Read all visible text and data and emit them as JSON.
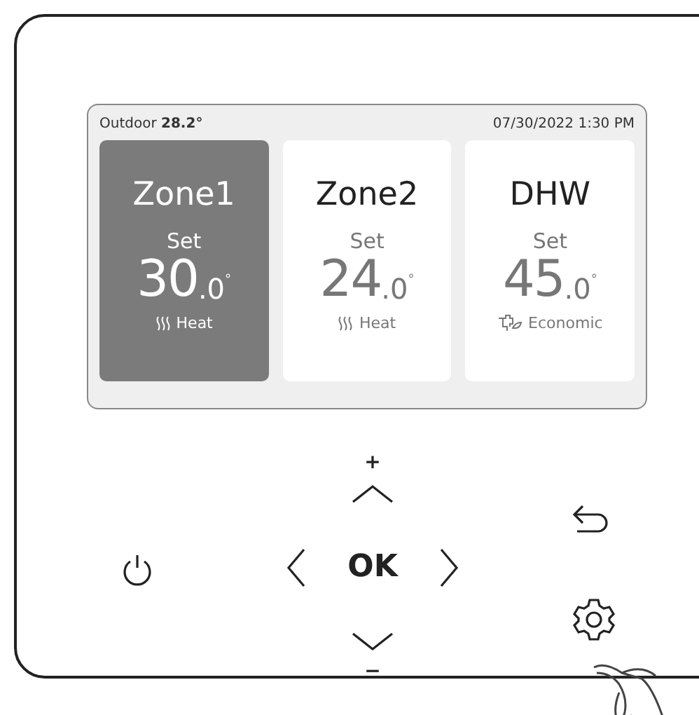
{
  "screen": {
    "outdoor": "Outdoor **28.2°**",
    "datetime": "07/30/2022 1:30 PM",
    "zones": [
      {
        "name": "Zone1",
        "set_label": "Set",
        "whole": "30",
        "fraction": ".0",
        "unit": "°",
        "mode": "Heat",
        "kind": "heat",
        "selected": true
      },
      {
        "name": "Zone2",
        "set_label": "Set",
        "whole": "24",
        "fraction": ".0",
        "unit": "°",
        "mode": "Heat",
        "kind": "heat",
        "selected": false
      },
      {
        "name": "DHW",
        "set_label": "Set",
        "whole": "45",
        "fraction": ".0",
        "unit": "°",
        "mode": "Economic",
        "kind": "eco",
        "selected": false
      }
    ]
  },
  "controls": {
    "plus": "+",
    "ok": "OK",
    "minus": "−"
  }
}
